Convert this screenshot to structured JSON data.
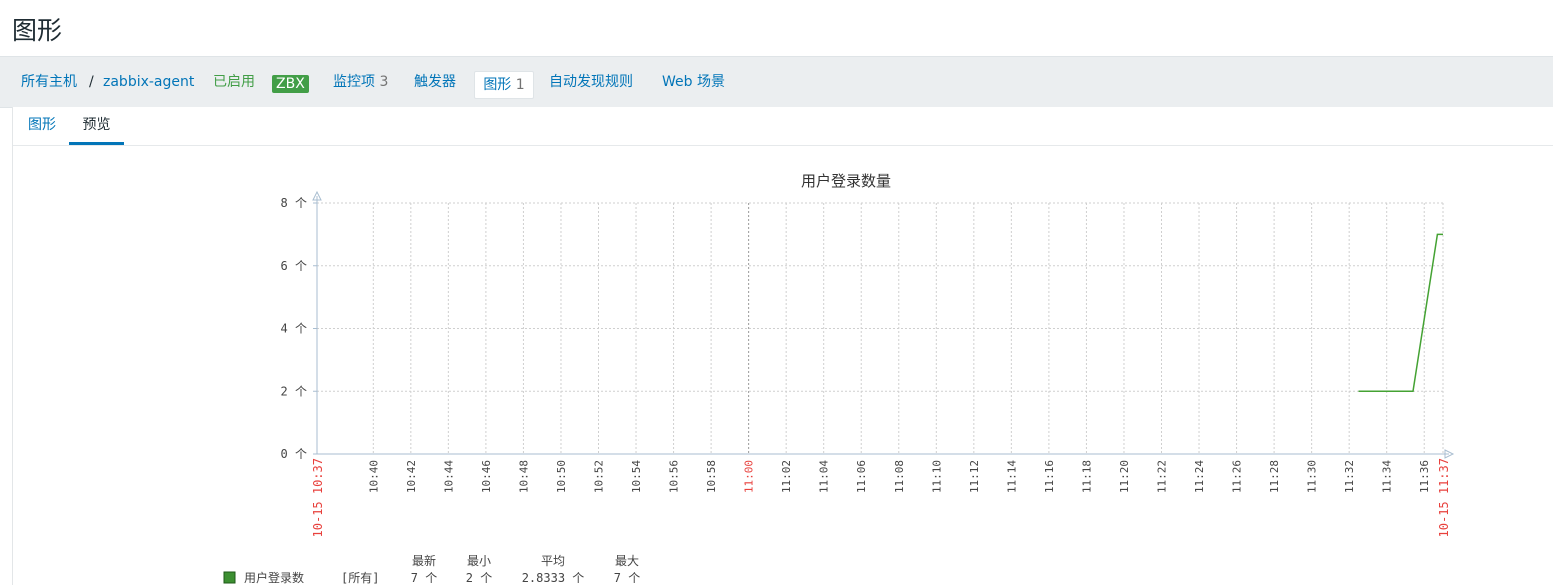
{
  "page_title": "图形",
  "host_nav": {
    "all_hosts": "所有主机",
    "separator": "/",
    "host_name": "zabbix-agent",
    "status": "已启用",
    "zbx_badge": "ZBX",
    "items_label": "监控项",
    "items_count": "3",
    "triggers_label": "触发器",
    "graphs_label": "图形",
    "graphs_count": "1",
    "discovery_label": "自动发现规则",
    "web_label": "Web 场景"
  },
  "tabs": [
    "图形",
    "预览"
  ],
  "active_tab": "预览",
  "colors": {
    "link": "#0275b8",
    "enabled": "#429e47",
    "series": "#44a233",
    "red_label": "#e8413d"
  },
  "chart_data": {
    "type": "line",
    "title": "用户登录数量",
    "ylim": [
      0,
      8
    ],
    "y_ticks": [
      "0 个",
      "2 个",
      "4 个",
      "6 个",
      "8 个"
    ],
    "x_start_label": "10-15 10:37",
    "x_end_label": "10-15 11:37",
    "x_tick_labels": [
      "10:40",
      "10:42",
      "10:44",
      "10:46",
      "10:48",
      "10:50",
      "10:52",
      "10:54",
      "10:56",
      "10:58",
      "11:00",
      "11:02",
      "11:04",
      "11:06",
      "11:08",
      "11:10",
      "11:12",
      "11:14",
      "11:16",
      "11:18",
      "11:20",
      "11:22",
      "11:24",
      "11:26",
      "11:28",
      "11:30",
      "11:32",
      "11:34",
      "11:36"
    ],
    "highlight_tick": "11:00",
    "x_range_minutes": [
      0,
      60
    ],
    "grid": true,
    "series": [
      {
        "name": "用户登录数",
        "color": "#44a233",
        "points": [
          [
            55.5,
            2
          ],
          [
            56.5,
            2
          ],
          [
            58.4,
            2
          ],
          [
            59.7,
            7
          ],
          [
            60,
            7
          ]
        ]
      }
    ],
    "legend": {
      "headers": [
        "最新",
        "最小",
        "平均",
        "最大"
      ],
      "rows": [
        {
          "name": "用户登录数",
          "func": "[所有]",
          "last": "7 个",
          "min": "2 个",
          "avg": "2.8333 个",
          "max": "7 个"
        }
      ]
    }
  }
}
